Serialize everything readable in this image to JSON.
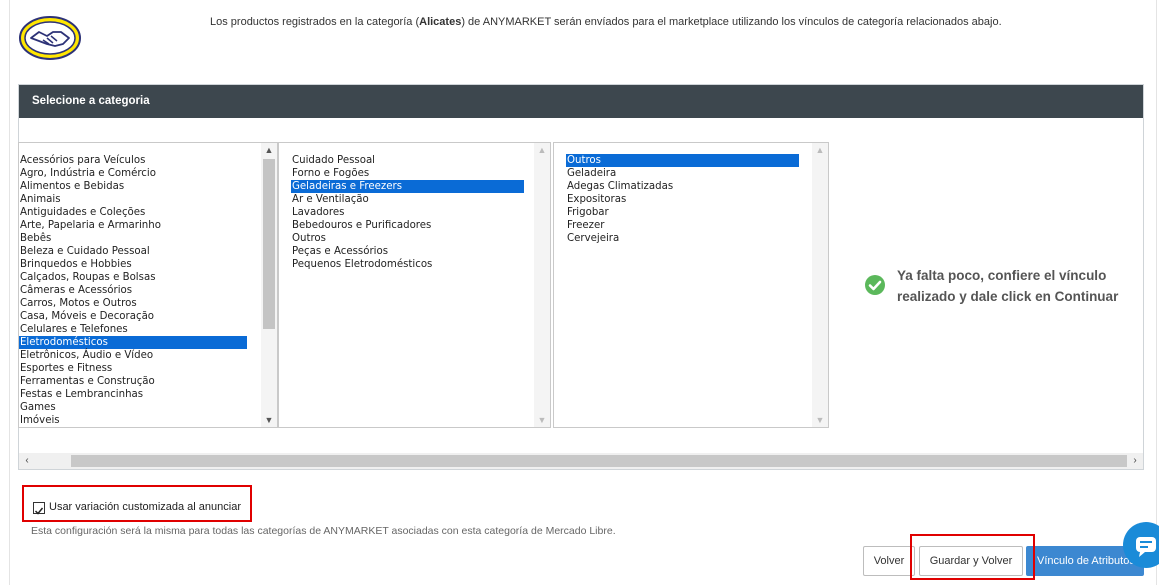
{
  "header": {
    "intro_prefix": "Los productos registrados en la categoría (",
    "intro_category": "Alicates",
    "intro_suffix": ") de ANYMARKET serán envíados para el marketplace utilizando los vínculos de categoría relacionados abajo."
  },
  "panel": {
    "title": "Selecione a categoria"
  },
  "lists": [
    {
      "items": [
        "Acessórios para Veículos",
        "Agro, Indústria e Comércio",
        "Alimentos e Bebidas",
        "Animais",
        "Antiguidades e Coleções",
        "Arte, Papelaria e Armarinho",
        "Bebês",
        "Beleza e Cuidado Pessoal",
        "Brinquedos e Hobbies",
        "Calçados, Roupas e Bolsas",
        "Câmeras e Acessórios",
        "Carros, Motos e Outros",
        "Casa, Móveis e Decoração",
        "Celulares e Telefones",
        "Eletrodomésticos",
        "Eletrônicos, Áudio e Vídeo",
        "Esportes e Fitness",
        "Ferramentas e Construção",
        "Festas e Lembrancinhas",
        "Games",
        "Imóveis"
      ],
      "selected": "Eletrodomésticos"
    },
    {
      "items": [
        "Cuidado Pessoal",
        "Forno e Fogões",
        "Geladeiras e Freezers",
        "Ar e Ventilação",
        "Lavadores",
        "Bebedouros e Purificadores",
        "Outros",
        "Peças e Acessórios",
        "Pequenos Eletrodomésticos"
      ],
      "selected": "Geladeiras e Freezers"
    },
    {
      "items": [
        "Outros",
        "Geladeira",
        "Adegas Climatizadas",
        "Expositoras",
        "Frigobar",
        "Freezer",
        "Cervejeira"
      ],
      "selected": "Outros"
    }
  ],
  "notice": {
    "text": "Ya falta poco, confiere el vínculo realizado y dale click en Continuar"
  },
  "variation": {
    "label": "Usar variación customizada al anunciar",
    "checked": true
  },
  "config_note": "Esta configuración será la misma para todas las categorías de ANYMARKET asociadas con esta categoría de Mercado Libre.",
  "buttons": {
    "volver": "Volver",
    "guardar": "Guardar y Volver",
    "vinculo": "Vínculo de Atributos"
  },
  "colors": {
    "panel_header": "#3d474e",
    "selection": "#0a6bd6",
    "success": "#5bb85b",
    "highlight": "#e00000",
    "primary_button": "#3c88d1"
  },
  "icons": {
    "logo": "mercadolibre-handshake-logo",
    "notice": "check-circle-icon",
    "chat": "chat-bubble-icon"
  }
}
